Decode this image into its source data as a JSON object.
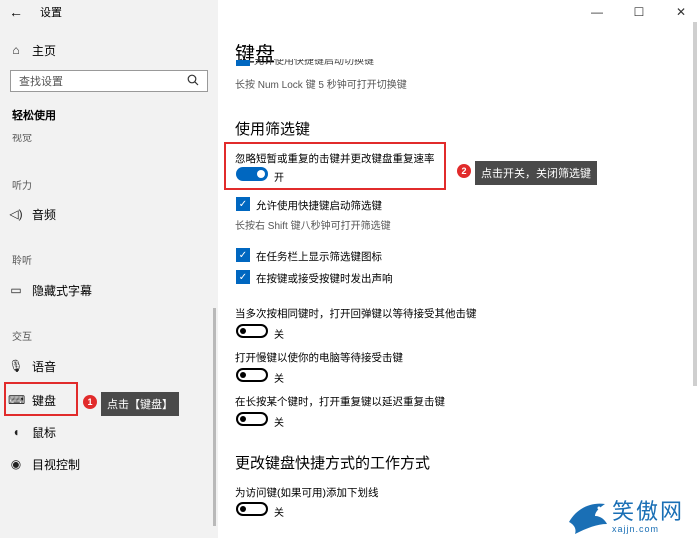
{
  "window": {
    "app_title": "设置",
    "back_glyph": "←",
    "minimize_glyph": "—",
    "maximize_glyph": "☐",
    "close_glyph": "✕"
  },
  "sidebar": {
    "home_label": "主页",
    "search_placeholder": "查找设置",
    "category_title": "轻松使用",
    "clipped_label": "视觉",
    "sections": {
      "hearing": "听力",
      "interaction": "交互",
      "hearing2": "聆听"
    },
    "items": [
      {
        "label": "音频",
        "icon": "speaker-icon"
      },
      {
        "label": "隐藏式字幕",
        "icon": "captions-icon"
      },
      {
        "label": "语音",
        "icon": "microphone-icon"
      },
      {
        "label": "键盘",
        "icon": "keyboard-icon"
      },
      {
        "label": "鼠标",
        "icon": "mouse-icon"
      },
      {
        "label": "目视控制",
        "icon": "eye-control-icon"
      }
    ]
  },
  "annotations": {
    "step1_number": "1",
    "step1_text": "点击【键盘】",
    "step2_number": "2",
    "step2_text": "点击开关，关闭筛选键",
    "accent": "#e12b2b"
  },
  "main": {
    "title": "键盘",
    "clipped_check_text": "允许使用快捷键启动切换键",
    "numlock_hint": "长按 Num Lock 键 5 秒钟可打开切换键",
    "filter_heading": "使用筛选键",
    "filter_label": "忽略短暂或重复的击键并更改键盘重复速率",
    "filter_state": "开",
    "shortcut_check": "允许使用快捷键启动筛选键",
    "shortcut_hint": "长按右 Shift 键八秒钟可打开筛选键",
    "taskbar_check": "在任务栏上显示筛选键图标",
    "sound_check": "在按键或接受按键时发出声响",
    "bounce_label": "当多次按相同键时，打开回弹键以等待接受其他击键",
    "bounce_state": "关",
    "slow_label": "打开慢键以使你的电脑等待接受击键",
    "slow_state": "关",
    "repeat_label": "在长按某个键时，打开重复键以延迟重复击键",
    "repeat_state": "关",
    "shortcut_heading": "更改键盘快捷方式的工作方式",
    "underline_label": "为访问键(如果可用)添加下划线",
    "underline_state": "关",
    "accent_color": "#0067c0"
  },
  "watermark": {
    "brand": "笑傲网",
    "url": "xajjn.com"
  }
}
